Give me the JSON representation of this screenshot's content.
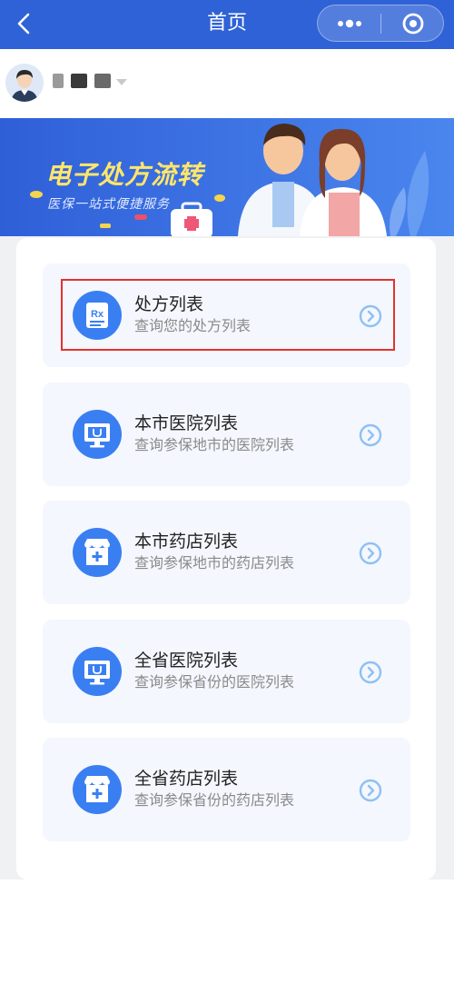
{
  "header": {
    "title": "首页"
  },
  "user": {
    "name": ""
  },
  "banner": {
    "title": "电子处方流转",
    "subtitle": "医保一站式便捷服务"
  },
  "menu": [
    {
      "title": "处方列表",
      "subtitle": "查询您的处方列表",
      "icon": "prescription-icon",
      "highlighted": true
    },
    {
      "title": "本市医院列表",
      "subtitle": "查询参保地市的医院列表",
      "icon": "hospital-monitor-icon",
      "highlighted": false
    },
    {
      "title": "本市药店列表",
      "subtitle": "查询参保地市的药店列表",
      "icon": "pharmacy-store-icon",
      "highlighted": false
    },
    {
      "title": "全省医院列表",
      "subtitle": "查询参保省份的医院列表",
      "icon": "hospital-monitor-icon",
      "highlighted": false
    },
    {
      "title": "全省药店列表",
      "subtitle": "查询参保省份的药店列表",
      "icon": "pharmacy-store-icon",
      "highlighted": false
    }
  ],
  "colors": {
    "header": "#2f62d6",
    "accent": "#3a7ff2",
    "highlight": "#e5312f"
  }
}
